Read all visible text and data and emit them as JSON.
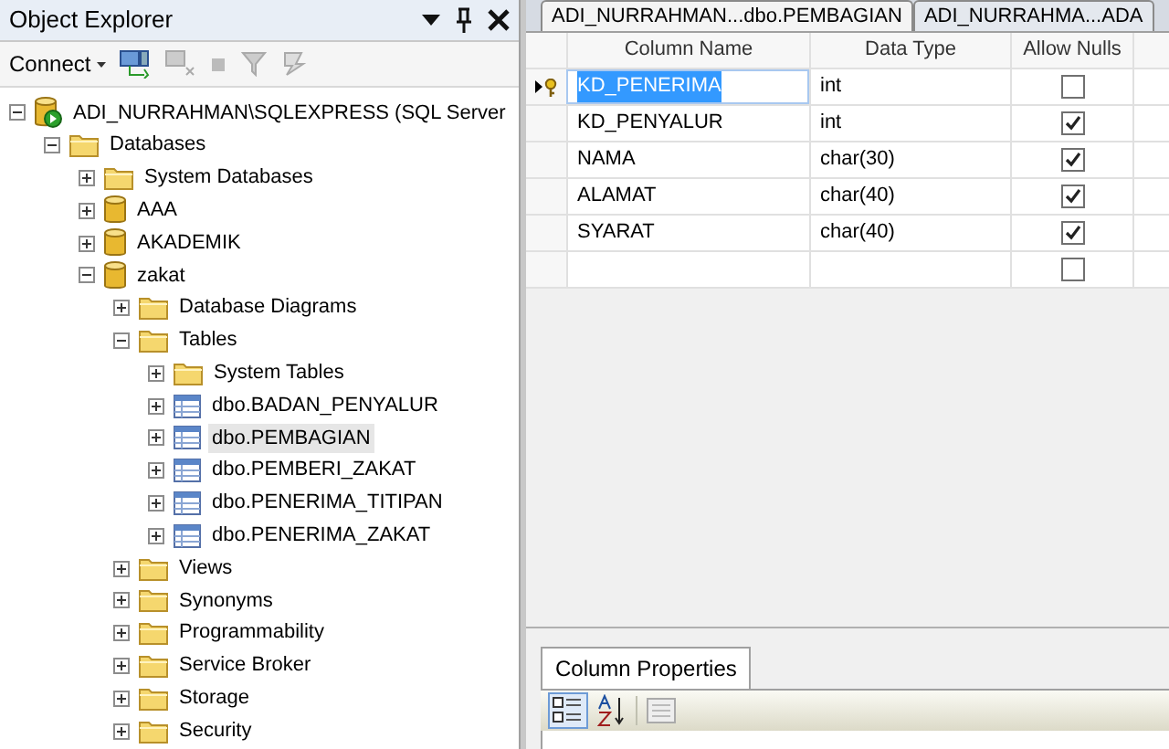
{
  "explorer": {
    "title": "Object Explorer",
    "connect": "Connect",
    "tree": [
      {
        "label": "ADI_NURRAHMAN\\SQLEXPRESS (SQL Server",
        "kind": "server",
        "expanded": true,
        "selected": false,
        "children": [
          {
            "label": "Databases",
            "kind": "folder",
            "expanded": true,
            "selected": false,
            "children": [
              {
                "label": "System Databases",
                "kind": "folder",
                "expanded": false,
                "selected": false
              },
              {
                "label": "AAA",
                "kind": "database",
                "expanded": false,
                "selected": false
              },
              {
                "label": "AKADEMIK",
                "kind": "database",
                "expanded": false,
                "selected": false
              },
              {
                "label": "zakat",
                "kind": "database",
                "expanded": true,
                "selected": false,
                "children": [
                  {
                    "label": "Database Diagrams",
                    "kind": "folder",
                    "expanded": false,
                    "selected": false
                  },
                  {
                    "label": "Tables",
                    "kind": "folder",
                    "expanded": true,
                    "selected": false,
                    "children": [
                      {
                        "label": "System Tables",
                        "kind": "folder",
                        "expanded": false,
                        "selected": false
                      },
                      {
                        "label": "dbo.BADAN_PENYALUR",
                        "kind": "table",
                        "expanded": false,
                        "selected": false
                      },
                      {
                        "label": "dbo.PEMBAGIAN",
                        "kind": "table",
                        "expanded": false,
                        "selected": true
                      },
                      {
                        "label": "dbo.PEMBERI_ZAKAT",
                        "kind": "table",
                        "expanded": false,
                        "selected": false
                      },
                      {
                        "label": "dbo.PENERIMA_TITIPAN",
                        "kind": "table",
                        "expanded": false,
                        "selected": false
                      },
                      {
                        "label": "dbo.PENERIMA_ZAKAT",
                        "kind": "table",
                        "expanded": false,
                        "selected": false
                      }
                    ]
                  },
                  {
                    "label": "Views",
                    "kind": "folder",
                    "expanded": false,
                    "selected": false
                  },
                  {
                    "label": "Synonyms",
                    "kind": "folder",
                    "expanded": false,
                    "selected": false
                  },
                  {
                    "label": "Programmability",
                    "kind": "folder",
                    "expanded": false,
                    "selected": false
                  },
                  {
                    "label": "Service Broker",
                    "kind": "folder",
                    "expanded": false,
                    "selected": false
                  },
                  {
                    "label": "Storage",
                    "kind": "folder",
                    "expanded": false,
                    "selected": false
                  },
                  {
                    "label": "Security",
                    "kind": "folder",
                    "expanded": false,
                    "selected": false
                  }
                ]
              }
            ]
          }
        ]
      }
    ]
  },
  "tabs": [
    {
      "label": "ADI_NURRAHMAN...dbo.PEMBAGIAN",
      "selected": true
    },
    {
      "label": "ADI_NURRAHMA...ADA",
      "selected": false
    }
  ],
  "grid": {
    "columns": [
      "Column Name",
      "Data Type",
      "Allow Nulls"
    ],
    "rows": [
      {
        "name": "KD_PENERIMA",
        "type": "int",
        "allow_nulls": false,
        "primary_key": true,
        "selected": true
      },
      {
        "name": "KD_PENYALUR",
        "type": "int",
        "allow_nulls": true,
        "primary_key": false,
        "selected": false
      },
      {
        "name": "NAMA",
        "type": "char(30)",
        "allow_nulls": true,
        "primary_key": false,
        "selected": false
      },
      {
        "name": "ALAMAT",
        "type": "char(40)",
        "allow_nulls": true,
        "primary_key": false,
        "selected": false
      },
      {
        "name": "SYARAT",
        "type": "char(40)",
        "allow_nulls": true,
        "primary_key": false,
        "selected": false
      },
      {
        "name": "",
        "type": "",
        "allow_nulls": false,
        "primary_key": false,
        "selected": false
      }
    ]
  },
  "properties": {
    "tab": "Column Properties"
  }
}
